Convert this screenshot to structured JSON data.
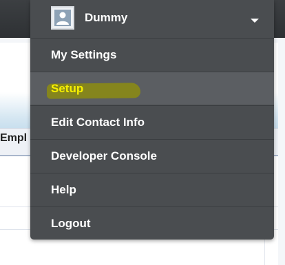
{
  "background": {
    "column_header": "Empl"
  },
  "user_menu": {
    "user_name": "Dummy",
    "avatar_icon": "user-avatar-icon",
    "caret_icon": "caret-down-icon",
    "items": [
      {
        "label": "My Settings"
      },
      {
        "label": "Setup"
      },
      {
        "label": "Edit Contact Info"
      },
      {
        "label": "Developer Console"
      },
      {
        "label": "Help"
      },
      {
        "label": "Logout"
      }
    ],
    "colors": {
      "menu_bg": "#4a4d50",
      "hover_bg": "#5b5e62",
      "highlight_text": "#f7f000",
      "highlighter_mark": "#8a8a16"
    }
  }
}
